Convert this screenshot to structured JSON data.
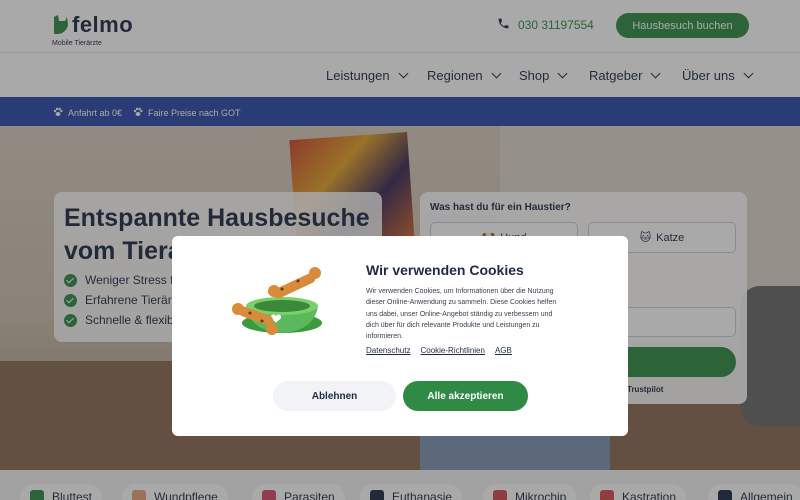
{
  "header": {
    "logo_text": "felmo",
    "logo_sub": "Mobile Tierärzte",
    "phone": "030 31197554",
    "cta_label": "Hausbesuch buchen"
  },
  "nav": {
    "items": [
      {
        "label": "Leistungen"
      },
      {
        "label": "Regionen"
      },
      {
        "label": "Shop"
      },
      {
        "label": "Ratgeber"
      },
      {
        "label": "Über uns"
      }
    ]
  },
  "infobar": {
    "items": [
      {
        "label": "Anfahrt ab 0€"
      },
      {
        "label": "Faire Preise nach GOT"
      }
    ]
  },
  "hero": {
    "title_line1": "Entspannte Hausbesuche",
    "title_line2": "vom Tierarzt",
    "benefits": [
      {
        "label": "Weniger Stress für dein Tier"
      },
      {
        "label": "Erfahrene Tierärzte"
      },
      {
        "label": "Schnelle & flexible Termine"
      }
    ]
  },
  "booking": {
    "question": "Was hast du für ein Haustier?",
    "pets": [
      {
        "label": "Hund",
        "icon": "dog-icon"
      },
      {
        "label": "Katze",
        "icon": "cat-icon"
      }
    ],
    "trust_label": "Trustpilot"
  },
  "cookie": {
    "title": "Wir verwenden Cookies",
    "text": "Wir verwenden Cookies, um Informationen über die Nutzung dieser Online-Anwendung zu sammeln. Diese Cookies helfen uns dabei, unser Online-Angebot ständig zu verbessern und dich über für dich relevante Produkte und Leistungen zu informieren.",
    "links": [
      {
        "label": "Datenschutz"
      },
      {
        "label": "Cookie-Richtlinien"
      },
      {
        "label": "AGB"
      }
    ],
    "reject_label": "Ablehnen",
    "accept_label": "Alle akzeptieren"
  },
  "categories": [
    {
      "label": "Bluttest",
      "icon": "syringe-icon",
      "color": "#2f8a45"
    },
    {
      "label": "Wundpflege",
      "icon": "bandage-icon",
      "color": "#e8a27a"
    },
    {
      "label": "Parasiten",
      "icon": "worm-icon",
      "color": "#d64b6a"
    },
    {
      "label": "Euthanasie",
      "icon": "heart-icon",
      "color": "#1f2a44"
    },
    {
      "label": "Mikrochip",
      "icon": "pin-icon",
      "color": "#d64b4b"
    },
    {
      "label": "Kastration",
      "icon": "scissors-icon",
      "color": "#d64b4b"
    },
    {
      "label": "Allgemein",
      "icon": "stethoscope-icon",
      "color": "#1f2a44"
    }
  ],
  "colors": {
    "brand_green": "#2f8a45",
    "infobar_blue": "#2a4aa8",
    "text_dark": "#1f2a44"
  }
}
